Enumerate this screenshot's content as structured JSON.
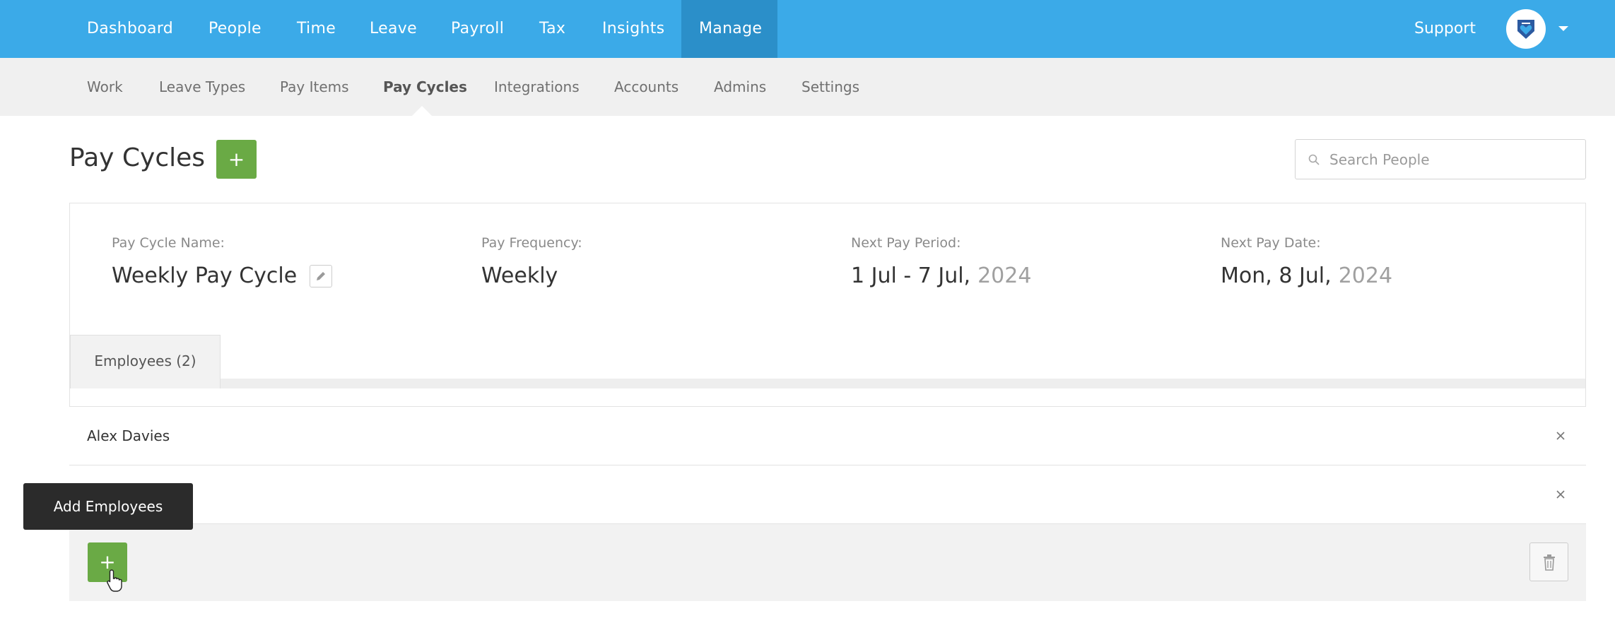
{
  "topnav": {
    "items": [
      {
        "label": "Dashboard"
      },
      {
        "label": "People"
      },
      {
        "label": "Time"
      },
      {
        "label": "Leave"
      },
      {
        "label": "Payroll"
      },
      {
        "label": "Tax"
      },
      {
        "label": "Insights"
      },
      {
        "label": "Manage"
      }
    ],
    "active": "Manage",
    "support_label": "Support"
  },
  "subnav": {
    "items": [
      {
        "label": "Work"
      },
      {
        "label": "Leave Types"
      },
      {
        "label": "Pay Items"
      },
      {
        "label": "Pay Cycles"
      },
      {
        "label": "Integrations"
      },
      {
        "label": "Accounts"
      },
      {
        "label": "Admins"
      },
      {
        "label": "Settings"
      }
    ],
    "active": "Pay Cycles"
  },
  "page": {
    "title": "Pay Cycles",
    "add_button_label": "+",
    "search_placeholder": "Search People"
  },
  "pay_cycle": {
    "name_label": "Pay Cycle Name:",
    "name": "Weekly Pay Cycle",
    "frequency_label": "Pay Frequency:",
    "frequency": "Weekly",
    "next_period_label": "Next Pay Period:",
    "next_period": "1 Jul - 7 Jul,",
    "next_period_year": "2024",
    "next_date_label": "Next Pay Date:",
    "next_date": "Mon, 8 Jul,",
    "next_date_year": "2024"
  },
  "tabs": {
    "employees_label": "Employees (2)"
  },
  "employees": [
    {
      "name": "Alex Davies"
    },
    {
      "name": ""
    }
  ],
  "actions": {
    "add_employees_label": "+",
    "tooltip": "Add Employees"
  },
  "icons": {
    "search": "search-icon",
    "edit": "pencil-icon",
    "remove": "close-icon",
    "delete": "trash-icon",
    "avatar": "logo-heart-icon",
    "caret": "chevron-down-icon",
    "cursor": "hand-pointer-icon"
  },
  "colors": {
    "primary_blue": "#3baae8",
    "active_nav": "#2b8fc9",
    "green_button": "#6aaa45",
    "tooltip_bg": "#2b2b2b"
  }
}
